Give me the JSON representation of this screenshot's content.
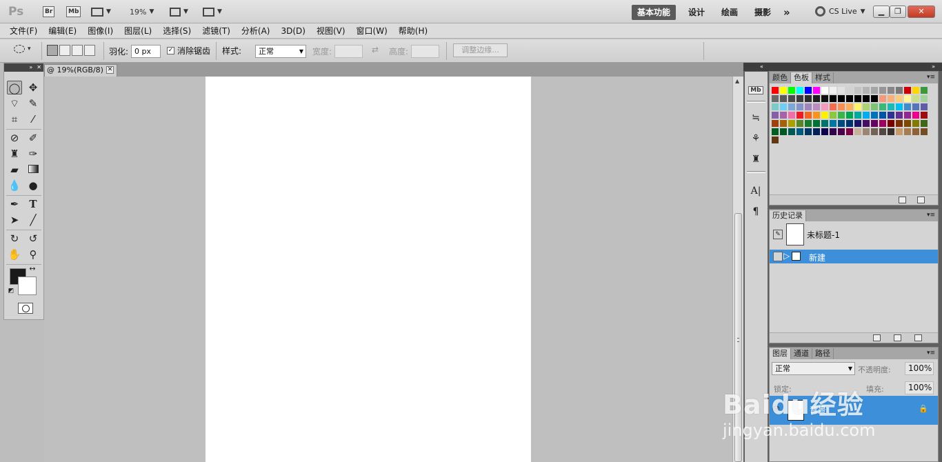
{
  "appbar": {
    "logo": "Ps",
    "br": "Br",
    "mb": "Mb",
    "zoom": "19%",
    "workspaces": [
      "基本功能",
      "设计",
      "绘画",
      "摄影"
    ],
    "more": "»",
    "cslive": "CS Live"
  },
  "menu": [
    "文件(F)",
    "编辑(E)",
    "图像(I)",
    "图层(L)",
    "选择(S)",
    "滤镜(T)",
    "分析(A)",
    "3D(D)",
    "视图(V)",
    "窗口(W)",
    "帮助(H)"
  ],
  "options": {
    "feather_label": "羽化:",
    "feather_value": "0 px",
    "antialias_label": "消除锯齿",
    "antialias_checked": true,
    "style_label": "样式:",
    "style_value": "正常",
    "width_label": "宽度:",
    "height_label": "高度:",
    "refine_label": "调整边缘..."
  },
  "document": {
    "tab_title": "@ 19%(RGB/8)"
  },
  "panels": {
    "color_tabs": [
      "颜色",
      "色板",
      "样式"
    ],
    "active_color_tab": "色板",
    "history_tab": "历史记录",
    "history_items": [
      "未标题-1",
      "新建"
    ],
    "layer_tabs": [
      "图层",
      "通道",
      "路径"
    ],
    "blend_mode": "正常",
    "opacity_label": "不透明度:",
    "opacity_value": "100%",
    "fill_label": "填充:",
    "fill_value": "100%",
    "lock_label": "锁定:",
    "layer_name": "背景"
  },
  "swatches": [
    "#ff0000",
    "#ffff00",
    "#00ff00",
    "#00ffff",
    "#0000ff",
    "#ff00ff",
    "#ffffff",
    "#f0f0f0",
    "#e1e1e1",
    "#d2d2d2",
    "#c3c3c3",
    "#b4b4b4",
    "#a5a5a5",
    "#969696",
    "#878787",
    "#787878",
    "#cc0000",
    "#ffd700",
    "#3a9a3a",
    "#696969",
    "#5a5a5a",
    "#4b4b4b",
    "#3c3c3c",
    "#2d2d2d",
    "#1e1e1e",
    "#0f0f0f",
    "#000000",
    "#000000",
    "#000000",
    "#000000",
    "#000000",
    "#000000",
    "#f39a7a",
    "#f5b07c",
    "#f8cb7f",
    "#fff699",
    "#c6df89",
    "#a3d39c",
    "#7accc8",
    "#6dcff6",
    "#7da7d9",
    "#8493ca",
    "#a186be",
    "#bd8cbf",
    "#f49ac1",
    "#f26c4f",
    "#f68e56",
    "#fbaf5c",
    "#fff467",
    "#acd372",
    "#7cc576",
    "#3bb878",
    "#1abbb4",
    "#00bff3",
    "#438ccb",
    "#5574b9",
    "#605ca8",
    "#855fa8",
    "#a763a8",
    "#f06ea9",
    "#ed1c24",
    "#f26522",
    "#f7941d",
    "#fff200",
    "#8dc63f",
    "#39b54a",
    "#00a651",
    "#00a99d",
    "#00aeef",
    "#0072bc",
    "#0054a6",
    "#2e3192",
    "#662d91",
    "#92278f",
    "#ec008c",
    "#9e0b0f",
    "#a0410d",
    "#a36209",
    "#aba000",
    "#598527",
    "#197b30",
    "#007236",
    "#00746b",
    "#0076a3",
    "#004b80",
    "#003471",
    "#1b1464",
    "#440e62",
    "#630460",
    "#9e005d",
    "#790000",
    "#7b2e00",
    "#7d4900",
    "#827b00",
    "#406618",
    "#005e20",
    "#005826",
    "#005952",
    "#005b7f",
    "#003663",
    "#002157",
    "#0d004c",
    "#32004b",
    "#4b0049",
    "#7b0046",
    "#c7b299",
    "#998675",
    "#736357",
    "#534741",
    "#37302d",
    "#c69c6d",
    "#a67c52",
    "#8c6239",
    "#754c24",
    "#603913"
  ],
  "colors": {
    "selection_blue": "#3c8fd8",
    "doc_bg": "#bfbfbf",
    "dock_bg": "#5f5f5f"
  },
  "watermark": {
    "main": "Baidu经验",
    "sub": "jingyan.baidu.com"
  }
}
